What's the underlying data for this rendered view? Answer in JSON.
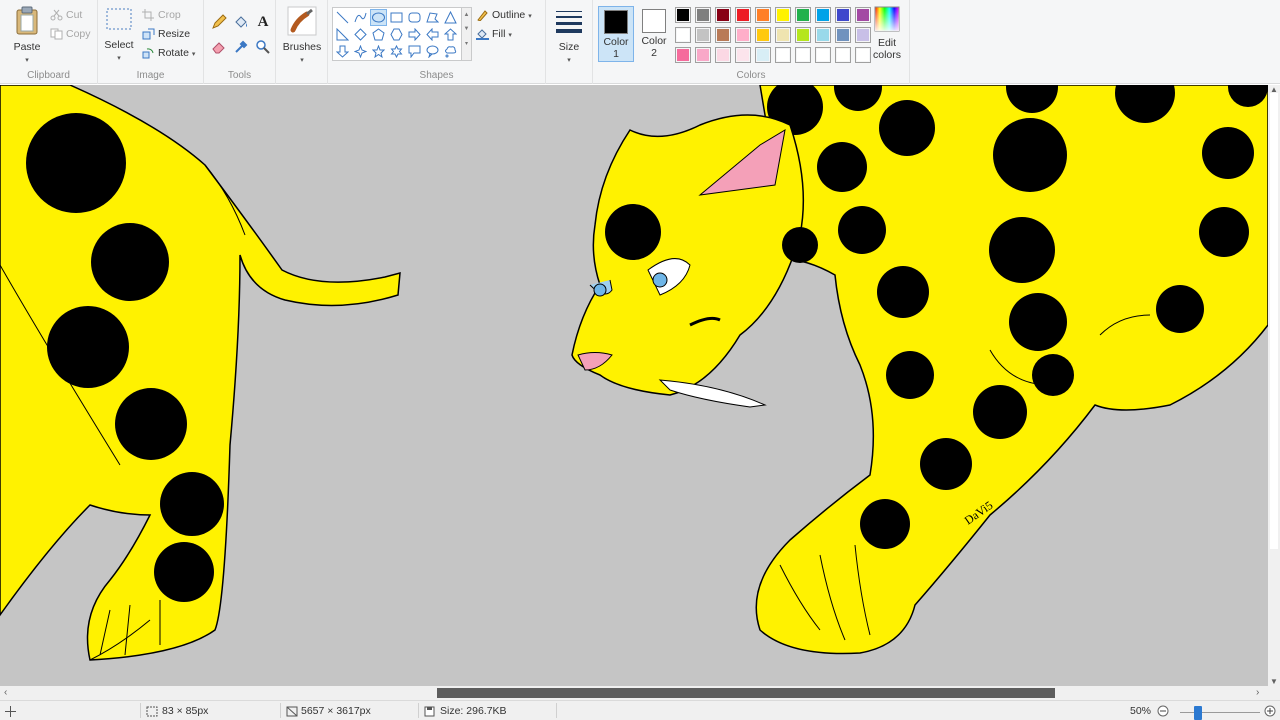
{
  "ribbon": {
    "clipboard": {
      "paste_label": "Paste",
      "cut_label": "Cut",
      "copy_label": "Copy",
      "group_label": "Clipboard"
    },
    "image": {
      "select_label": "Select",
      "crop_label": "Crop",
      "resize_label": "Resize",
      "rotate_label": "Rotate",
      "group_label": "Image"
    },
    "tools": {
      "group_label": "Tools",
      "text_glyph": "A"
    },
    "brushes": {
      "label": "Brushes"
    },
    "shapes": {
      "outline_label": "Outline",
      "fill_label": "Fill",
      "group_label": "Shapes"
    },
    "size": {
      "label": "Size"
    },
    "colors": {
      "color1_label": "Color",
      "color1_num": "1",
      "color2_label": "Color",
      "color2_num": "2",
      "color1_value": "#000000",
      "color2_value": "#ffffff",
      "edit_label": "Edit",
      "edit_label2": "colors",
      "group_label": "Colors",
      "palette": [
        "#000000",
        "#7f7f7f",
        "#880015",
        "#ed1c24",
        "#ff7f27",
        "#fff200",
        "#22b14c",
        "#00a2e8",
        "#3f48cc",
        "#a349a4",
        "#ffffff",
        "#c3c3c3",
        "#b97a57",
        "#ffaec9",
        "#ffc90e",
        "#efe4b0",
        "#b5e61d",
        "#99d9ea",
        "#7092be",
        "#c8bfe7",
        "#f56b9c",
        "#f9a8c8",
        "#fbd8e4",
        "#fce4ec",
        "#d8eef6",
        "#ffffff",
        "#ffffff",
        "#ffffff",
        "#ffffff",
        "#ffffff"
      ]
    }
  },
  "canvas": {
    "background": "#c5c5c5",
    "fur_color": "#fff200",
    "spot_color": "#000000",
    "signature": "DaVi5"
  },
  "statusbar": {
    "selection_size": "83 × 85px",
    "image_dimensions": "5657 × 3617px",
    "file_size": "Size: 296.7KB",
    "zoom": "50%"
  }
}
